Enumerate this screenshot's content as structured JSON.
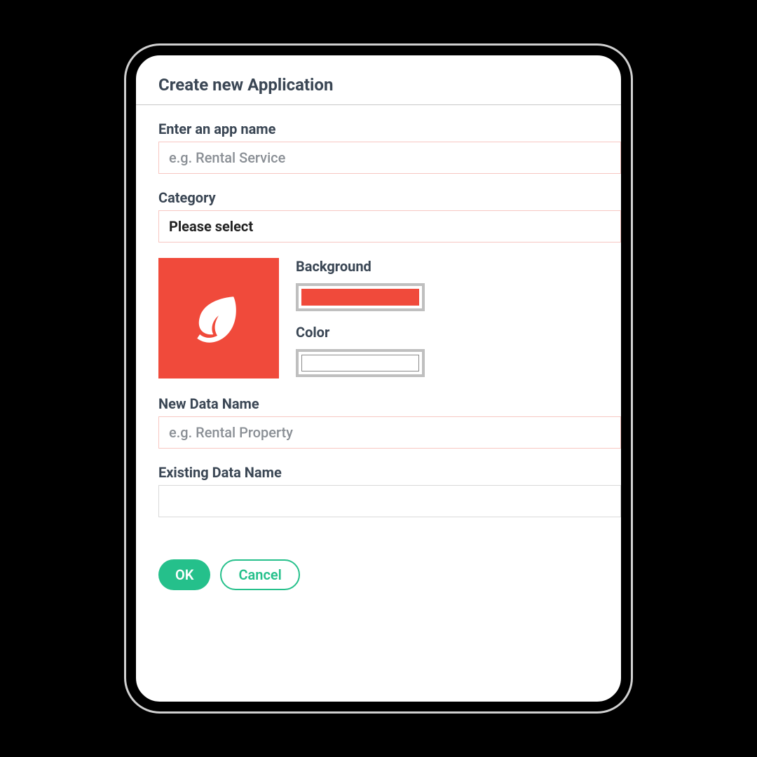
{
  "dialog": {
    "title": "Create new Application"
  },
  "fields": {
    "appName": {
      "label": "Enter an app name",
      "placeholder": "e.g. Rental Service",
      "value": ""
    },
    "category": {
      "label": "Category",
      "selected": "Please select"
    },
    "background": {
      "label": "Background",
      "color": "#f04a3b"
    },
    "iconColor": {
      "label": "Color",
      "color": "#ffffff"
    },
    "newDataName": {
      "label": "New Data Name",
      "placeholder": "e.g. Rental Property",
      "value": ""
    },
    "existingDataName": {
      "label": "Existing Data Name",
      "value": ""
    }
  },
  "icon": "leaf-icon",
  "buttons": {
    "ok": "OK",
    "cancel": "Cancel"
  }
}
